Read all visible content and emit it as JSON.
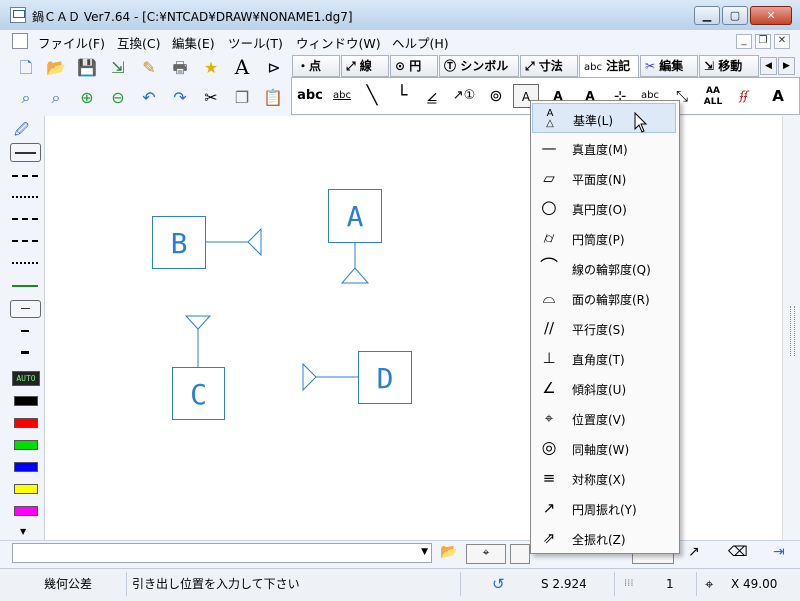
{
  "window": {
    "title": "鍋ＣＡＤ Ver7.64 - [C:¥NTCAD¥DRAW¥NONAME1.dg7]"
  },
  "menu": [
    "ファイル(F)",
    "互換(C)",
    "編集(E)",
    "ツール(T)",
    "ウィンドウ(W)",
    "ヘルプ(H)"
  ],
  "tabs": [
    {
      "label": "・点"
    },
    {
      "label": "⤢ 線"
    },
    {
      "label": "⊙ 円"
    },
    {
      "label": "シンボル"
    },
    {
      "label": "寸法"
    },
    {
      "label": "注記"
    },
    {
      "label": "編集"
    },
    {
      "label": "移動"
    }
  ],
  "tab_icons": {
    "symbol": "Ⓣ",
    "dim": "⤢",
    "note": "abc",
    "edit": "✂",
    "move": "⇲"
  },
  "toolbar_row1_text": "A",
  "subtoolbar": [
    "abc",
    "abc",
    "╲",
    "└",
    "⦤",
    "↗①",
    "⊚",
    "A",
    "A",
    "A",
    "⊹",
    "abc",
    "⤡",
    "AA ALL",
    "ʄʄ",
    "A"
  ],
  "drawing": {
    "labels": [
      "A",
      "B",
      "C",
      "D"
    ]
  },
  "dropdown": {
    "items": [
      {
        "label": "基準(L)",
        "icon": "datum-icon"
      },
      {
        "label": "真直度(M)",
        "icon": "straightness-icon"
      },
      {
        "label": "平面度(N)",
        "icon": "flatness-icon"
      },
      {
        "label": "真円度(O)",
        "icon": "circularity-icon"
      },
      {
        "label": "円筒度(P)",
        "icon": "cylindricity-icon"
      },
      {
        "label": "線の輪郭度(Q)",
        "icon": "line-profile-icon"
      },
      {
        "label": "面の輪郭度(R)",
        "icon": "surface-profile-icon"
      },
      {
        "label": "平行度(S)",
        "icon": "parallelism-icon"
      },
      {
        "label": "直角度(T)",
        "icon": "perpendicularity-icon"
      },
      {
        "label": "傾斜度(U)",
        "icon": "angularity-icon"
      },
      {
        "label": "位置度(V)",
        "icon": "position-icon"
      },
      {
        "label": "同軸度(W)",
        "icon": "concentricity-icon"
      },
      {
        "label": "対称度(X)",
        "icon": "symmetry-icon"
      },
      {
        "label": "円周振れ(Y)",
        "icon": "circular-runout-icon"
      },
      {
        "label": "全振れ(Z)",
        "icon": "total-runout-icon"
      }
    ]
  },
  "left_palette": {
    "auto_label": "AUTO"
  },
  "status": {
    "mode": "幾何公差",
    "message": "引き出し位置を入力して下さい",
    "scale": "S 2.924",
    "layer": "1",
    "coord": "X 49.00"
  },
  "colors": {
    "drawing_blue": "#2a7fd0",
    "palette": [
      "#000000",
      "#ff0000",
      "#00dd00",
      "#0000ff",
      "#ffff00",
      "#ff00ff"
    ]
  }
}
